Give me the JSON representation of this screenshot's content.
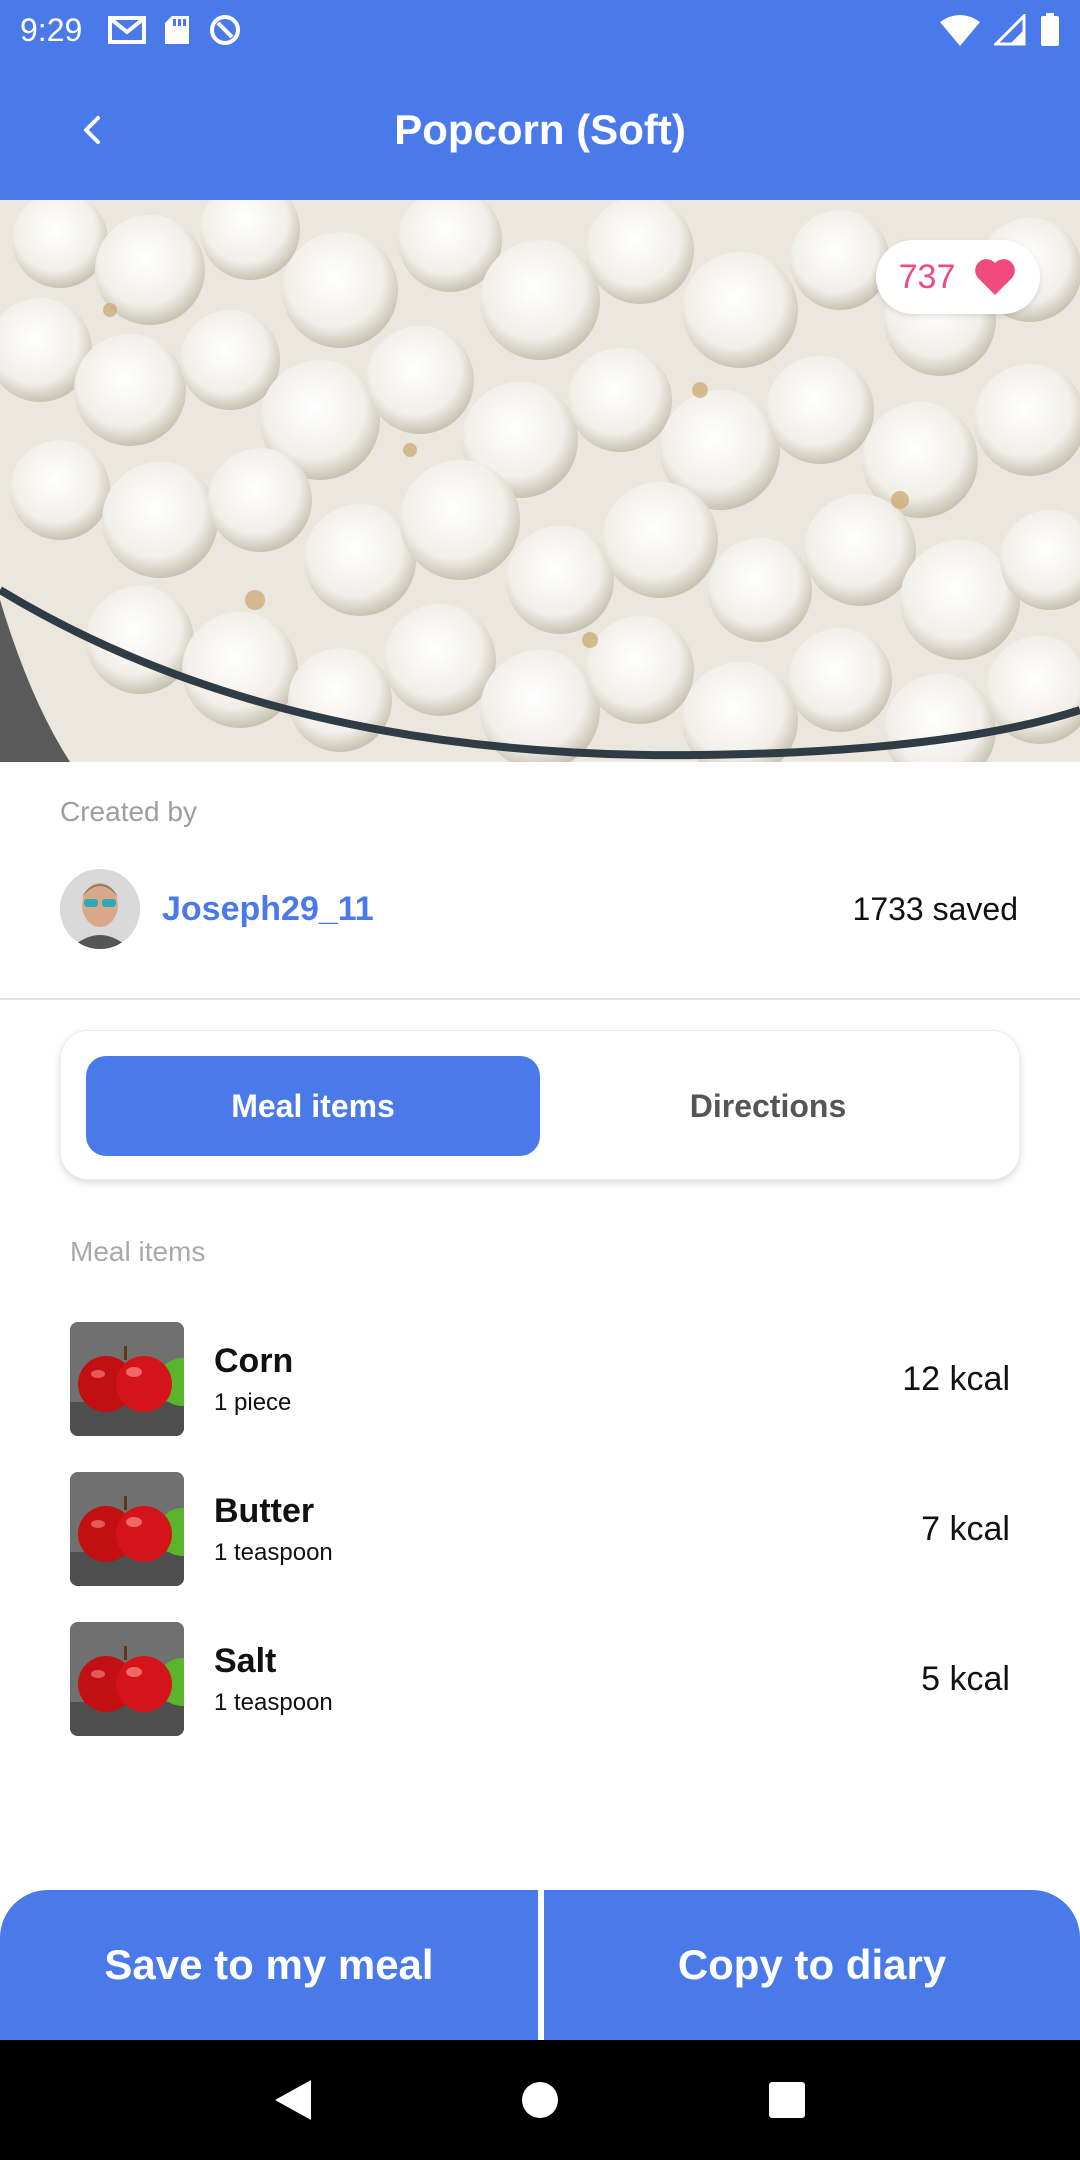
{
  "status_bar": {
    "time": "9:29"
  },
  "app_bar": {
    "title": "Popcorn (Soft)"
  },
  "hero": {
    "likes": "737"
  },
  "creator": {
    "label": "Created by",
    "username": "Joseph29_11",
    "saved": "1733 saved"
  },
  "tabs": [
    {
      "label": "Meal items",
      "active": true
    },
    {
      "label": "Directions",
      "active": false
    }
  ],
  "meal_section": {
    "label": "Meal items",
    "items": [
      {
        "name": "Corn",
        "quantity": "1 piece",
        "kcal": "12 kcal"
      },
      {
        "name": "Butter",
        "quantity": "1 teaspoon",
        "kcal": "7 kcal"
      },
      {
        "name": "Salt",
        "quantity": "1 teaspoon",
        "kcal": "5 kcal"
      }
    ]
  },
  "actions": {
    "save_label": "Save to my meal",
    "copy_label": "Copy to diary"
  },
  "colors": {
    "primary": "#4a7aea",
    "heart": "#f04a7e"
  }
}
